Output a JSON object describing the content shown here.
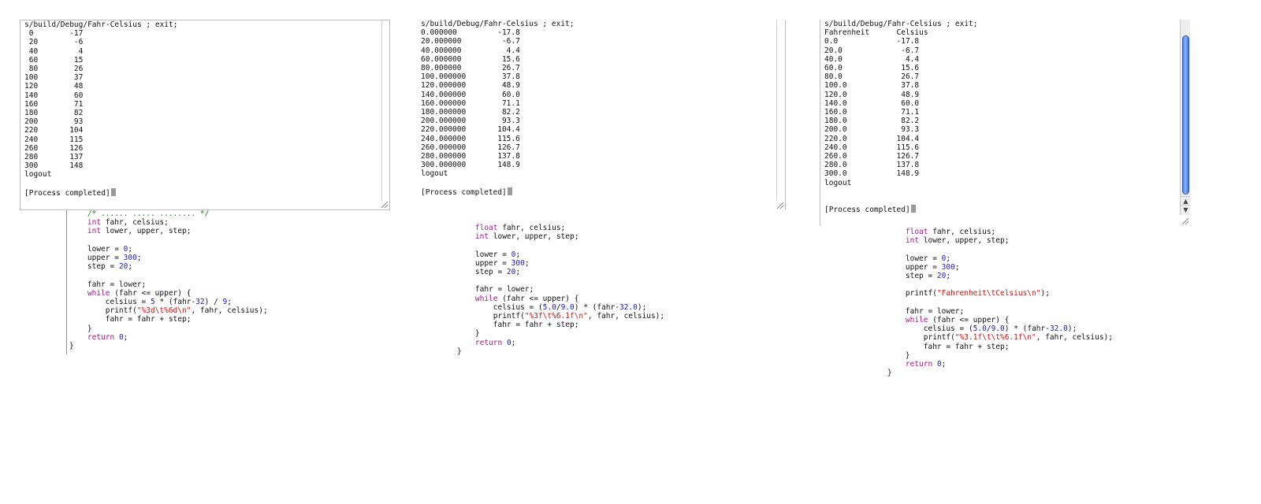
{
  "terminals": [
    {
      "header": "s/build/Debug/Fahr-Celsius ; exit;",
      "rows": [
        " 0        -17",
        " 20        -6",
        " 40         4",
        " 60        15",
        " 80        26",
        "100        37",
        "120        48",
        "140        60",
        "160        71",
        "180        82",
        "200        93",
        "220       104",
        "240       115",
        "260       126",
        "280       137",
        "300       148"
      ],
      "logout": "logout",
      "completed": "[Process completed]"
    },
    {
      "header": "s/build/Debug/Fahr-Celsius ; exit;",
      "rows": [
        "0.000000         -17.8",
        "20.000000         -6.7",
        "40.000000          4.4",
        "60.000000         15.6",
        "80.000000         26.7",
        "100.000000        37.8",
        "120.000000        48.9",
        "140.000000        60.0",
        "160.000000        71.1",
        "180.000000        82.2",
        "200.000000        93.3",
        "220.000000       104.4",
        "240.000000       115.6",
        "260.000000       126.7",
        "280.000000       137.8",
        "300.000000       148.9"
      ],
      "logout": "logout",
      "completed": "[Process completed]"
    },
    {
      "header": "s/build/Debug/Fahr-Celsius ; exit;",
      "column_header": "Fahrenheit      Celsius",
      "rows": [
        "0.0             -17.8",
        "20.0             -6.7",
        "40.0              4.4",
        "60.0             15.6",
        "80.0             26.7",
        "100.0            37.8",
        "120.0            48.9",
        "140.0            60.0",
        "160.0            71.1",
        "180.0            82.2",
        "200.0            93.3",
        "220.0           104.4",
        "240.0           115.6",
        "260.0           126.7",
        "280.0           137.8",
        "300.0           148.9"
      ],
      "logout": "logout",
      "completed": "[Process completed]"
    }
  ],
  "code_snippets": [
    {
      "lines": [
        [
          [
            "cmt",
            "    /* ...... ..... ........ */"
          ]
        ],
        [
          [
            "kw",
            "    int"
          ],
          [
            "",
            " fahr, celsius;"
          ]
        ],
        [
          [
            "kw",
            "    int"
          ],
          [
            "",
            " lower, upper, step;"
          ]
        ],
        [
          [
            "",
            ""
          ]
        ],
        [
          [
            "",
            "    lower = "
          ],
          [
            "num",
            "0"
          ],
          [
            "",
            ";"
          ]
        ],
        [
          [
            "",
            "    upper = "
          ],
          [
            "num",
            "300"
          ],
          [
            "",
            ";"
          ]
        ],
        [
          [
            "",
            "    step = "
          ],
          [
            "num",
            "20"
          ],
          [
            "",
            ";"
          ]
        ],
        [
          [
            "",
            ""
          ]
        ],
        [
          [
            "",
            "    fahr = lower;"
          ]
        ],
        [
          [
            "kw",
            "    while"
          ],
          [
            "",
            " (fahr <= upper) {"
          ]
        ],
        [
          [
            "",
            "        celsius = "
          ],
          [
            "num",
            "5"
          ],
          [
            "",
            " * (fahr-"
          ],
          [
            "num",
            "32"
          ],
          [
            "",
            ") / "
          ],
          [
            "num",
            "9"
          ],
          [
            "",
            ";"
          ]
        ],
        [
          [
            "",
            "        printf("
          ],
          [
            "str",
            "\"%3d\\t%6d\\n\""
          ],
          [
            "",
            ", fahr, celsius);"
          ]
        ],
        [
          [
            "",
            "        fahr = fahr + step;"
          ]
        ],
        [
          [
            "",
            "    }"
          ]
        ],
        [
          [
            "kw",
            "    return"
          ],
          [
            "",
            " "
          ],
          [
            "num",
            "0"
          ],
          [
            "",
            ";"
          ]
        ],
        [
          [
            "",
            "}"
          ]
        ]
      ]
    },
    {
      "lines": [
        [
          [
            "kw",
            "    float"
          ],
          [
            "",
            " fahr, celsius;"
          ]
        ],
        [
          [
            "kw",
            "    int"
          ],
          [
            "",
            " lower, upper, step;"
          ]
        ],
        [
          [
            "",
            ""
          ]
        ],
        [
          [
            "",
            "    lower = "
          ],
          [
            "num",
            "0"
          ],
          [
            "",
            ";"
          ]
        ],
        [
          [
            "",
            "    upper = "
          ],
          [
            "num",
            "300"
          ],
          [
            "",
            ";"
          ]
        ],
        [
          [
            "",
            "    step = "
          ],
          [
            "num",
            "20"
          ],
          [
            "",
            ";"
          ]
        ],
        [
          [
            "",
            ""
          ]
        ],
        [
          [
            "",
            "    fahr = lower;"
          ]
        ],
        [
          [
            "kw",
            "    while"
          ],
          [
            "",
            " (fahr <= upper) {"
          ]
        ],
        [
          [
            "",
            "        celsius = ("
          ],
          [
            "num",
            "5.0"
          ],
          [
            "",
            "/"
          ],
          [
            "num",
            "9.0"
          ],
          [
            "",
            ") * (fahr-"
          ],
          [
            "num",
            "32.0"
          ],
          [
            "",
            ");"
          ]
        ],
        [
          [
            "",
            "        printf("
          ],
          [
            "str",
            "\"%3f\\t%6.1f\\n\""
          ],
          [
            "",
            ", fahr, celsius);"
          ]
        ],
        [
          [
            "",
            "        fahr = fahr + step;"
          ]
        ],
        [
          [
            "",
            "    }"
          ]
        ],
        [
          [
            "kw",
            "    return"
          ],
          [
            "",
            " "
          ],
          [
            "num",
            "0"
          ],
          [
            "",
            ";"
          ]
        ],
        [
          [
            "",
            "}"
          ]
        ]
      ]
    },
    {
      "lines": [
        [
          [
            "kw",
            "    float"
          ],
          [
            "",
            " fahr, celsius;"
          ]
        ],
        [
          [
            "kw",
            "    int"
          ],
          [
            "",
            " lower, upper, step;"
          ]
        ],
        [
          [
            "",
            ""
          ]
        ],
        [
          [
            "",
            "    lower = "
          ],
          [
            "num",
            "0"
          ],
          [
            "",
            ";"
          ]
        ],
        [
          [
            "",
            "    upper = "
          ],
          [
            "num",
            "300"
          ],
          [
            "",
            ";"
          ]
        ],
        [
          [
            "",
            "    step = "
          ],
          [
            "num",
            "20"
          ],
          [
            "",
            ";"
          ]
        ],
        [
          [
            "",
            ""
          ]
        ],
        [
          [
            "",
            "    printf("
          ],
          [
            "str",
            "\"Fahrenheit\\tCelsius\\n\""
          ],
          [
            "",
            ");"
          ]
        ],
        [
          [
            "",
            ""
          ]
        ],
        [
          [
            "",
            "    fahr = lower;"
          ]
        ],
        [
          [
            "kw",
            "    while"
          ],
          [
            "",
            " (fahr <= upper) {"
          ]
        ],
        [
          [
            "",
            "        celsius = ("
          ],
          [
            "num",
            "5.0"
          ],
          [
            "",
            "/"
          ],
          [
            "num",
            "9.0"
          ],
          [
            "",
            ") * (fahr-"
          ],
          [
            "num",
            "32.0"
          ],
          [
            "",
            ");"
          ]
        ],
        [
          [
            "",
            "        printf("
          ],
          [
            "str",
            "\"%3.1f\\t\\t%6.1f\\n\""
          ],
          [
            "",
            ", fahr, celsius);"
          ]
        ],
        [
          [
            "",
            "        fahr = fahr + step;"
          ]
        ],
        [
          [
            "",
            "    }"
          ]
        ],
        [
          [
            "kw",
            "    return"
          ],
          [
            "",
            " "
          ],
          [
            "num",
            "0"
          ],
          [
            "",
            ";"
          ]
        ],
        [
          [
            "",
            "}"
          ]
        ]
      ]
    }
  ],
  "scrollbar": {
    "up_arrow": "▲",
    "down_arrow": "▼",
    "thumb_color": "#4a7fe0"
  },
  "icons": {
    "resize_grip": "resize-grip-icon",
    "cursor": "text-cursor"
  }
}
